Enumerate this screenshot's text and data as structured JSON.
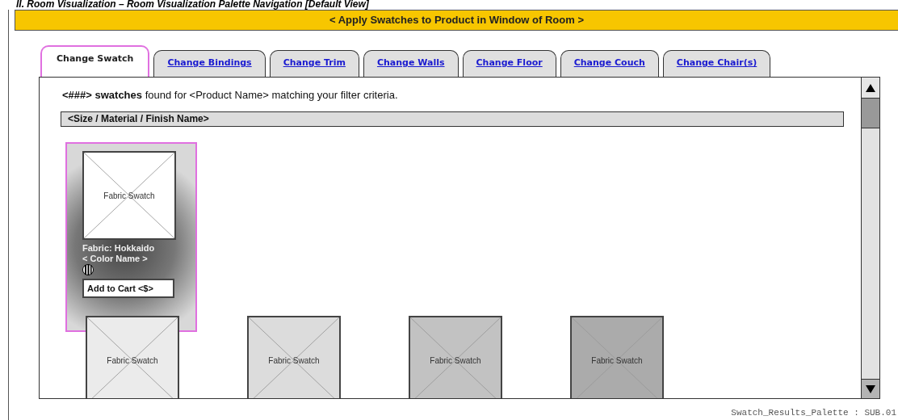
{
  "page_title": "II. Room Visualization – Room Visualization Palette Navigation [Default View]",
  "banner": "< Apply Swatches to Product in Window of Room >",
  "tabs": [
    {
      "label": "Change Swatch",
      "selected": true
    },
    {
      "label": "Change Bindings",
      "selected": false
    },
    {
      "label": "Change Trim",
      "selected": false
    },
    {
      "label": "Change Walls",
      "selected": false
    },
    {
      "label": "Change Floor",
      "selected": false
    },
    {
      "label": "Change Couch",
      "selected": false
    },
    {
      "label": "Change Chair(s)",
      "selected": false
    }
  ],
  "results_message": "**<###>  swatches** found for <Product Name> matching your filter criteria.",
  "group_header": "<Size / Material / Finish Name>",
  "swatches": [
    {
      "label": "Fabric Swatch",
      "selected": true,
      "color": "#ffffff",
      "fabric": "Fabric: Hokkaido",
      "color_name": "< Color Name >",
      "button": "Add to Cart <$>"
    },
    {
      "label": "Fabric Swatch",
      "selected": false,
      "color": "#ebebeb"
    },
    {
      "label": "Fabric Swatch",
      "selected": false,
      "color": "#dcdcdc"
    },
    {
      "label": "Fabric Swatch",
      "selected": false,
      "color": "#c2c2c2"
    },
    {
      "label": "Fabric Swatch",
      "selected": false,
      "color": "#ababab"
    }
  ],
  "footer": "Swatch_Results_Palette : SUB.01"
}
